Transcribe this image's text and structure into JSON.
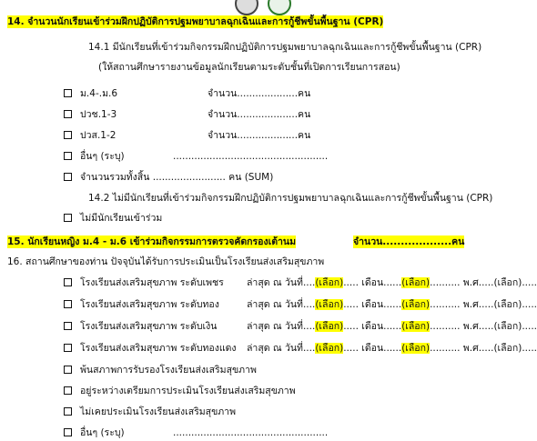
{
  "q14": {
    "title": "14. จำนวนนักเรียนเข้าร่วมฝึกปฏิบัติการปฐมพยาบาลฉุกเฉินและการกู้ชีพขั้นพื้นฐาน (CPR)",
    "sub1": "14.1  มีนักเรียนที่เข้าร่วมกิจกรรมฝึกปฏิบัติการปฐมพยาบาลฉุกเฉินและการกู้ชีพขั้นพื้นฐาน (CPR)",
    "note": "(ให้สถานศึกษารายงานข้อมูลนักเรียนตามระดับชั้นที่เปิดการเรียนการสอน)",
    "rows": [
      {
        "label": "ม.4-.ม.6",
        "count": "จำนวน....................คน"
      },
      {
        "label": "ปวช.1-3",
        "count": "จำนวน....................คน"
      },
      {
        "label": "ปวส.1-2",
        "count": "จำนวน....................คน"
      }
    ],
    "other": "อื่นๆ (ระบุ)",
    "other_dots": "...................................................",
    "total": "จำนวนรวมทั้งสิ้น  ........................  คน (SUM)",
    "sub2": "14.2  ไม่มีนักเรียนที่เข้าร่วมกิจกรรมฝึกปฏิบัติการปฐมพยาบาลฉุกเฉินและการกู้ชีพขั้นพื้นฐาน (CPR)",
    "none": "ไม่มีนักเรียนเข้าร่วม"
  },
  "q15": {
    "title": "15. นักเรียนหญิง ม.4 - ม.6 เข้าร่วมกิจกรรมการตรวจคัดกรองเต้านม",
    "count": "จำนวน...................คน"
  },
  "q16": {
    "title": "16. สถานศึกษาของท่าน ปัจจุบันได้รับการประเมินเป็นโรงเรียนส่งเสริมสุขภาพ",
    "levels": [
      "โรงเรียนส่งเสริมสุขภาพ ระดับเพชร",
      "โรงเรียนส่งเสริมสุขภาพ ระดับทอง",
      "โรงเรียนส่งเสริมสุขภาพ ระดับเงิน",
      "โรงเรียนส่งเสริมสุขภาพ ระดับทองแดง"
    ],
    "latest": "ล่าสุด ณ วันที่....",
    "select": "(เลือก)",
    "dots": ".....",
    "month": "เดือน......",
    "dots2": "..........",
    "year": "พ.ศ.....",
    "dots3": "......",
    "others": [
      "พ้นสภาพการรับรองโรงเรียนส่งเสริมสุขภาพ",
      "อยู่ระหว่างเตรียมการประเมินโรงเรียนส่งเสริมสุขภาพ",
      "ไม่เคยประเมินโรงเรียนส่งเสริมสุขภาพ"
    ],
    "other": "อื่นๆ (ระบุ)",
    "other_dots": "..................................................."
  }
}
